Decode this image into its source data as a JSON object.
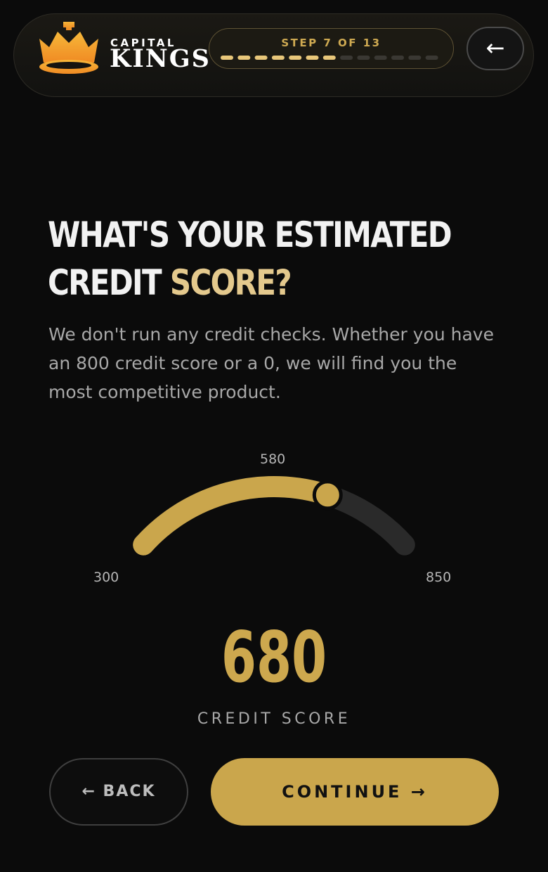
{
  "header": {
    "logo_top": "CAPITAL",
    "logo_bottom": "KINGS",
    "step_label": "STEP 7 OF 13",
    "step_current": 7,
    "step_total": 13,
    "back_icon": "←"
  },
  "question": {
    "title_main": "WHAT'S YOUR ESTIMATED CREDIT",
    "title_accent": "SCORE?",
    "subtitle": "We don't run any credit checks. Whether you have an 800 credit score or a 0, we will find you the most competitive product."
  },
  "gauge": {
    "min": 300,
    "mid": 580,
    "max": 850,
    "min_label": "300",
    "mid_label": "580",
    "max_label": "850",
    "value": 680
  },
  "score": {
    "value": "680",
    "caption": "CREDIT SCORE"
  },
  "actions": {
    "back_label": "← BACK",
    "continue_label": "CONTINUE →"
  },
  "colors": {
    "accent": "#caa64c",
    "title_accent": "#e4c98d",
    "background": "#0b0b0b",
    "track": "#2a2a2a"
  }
}
